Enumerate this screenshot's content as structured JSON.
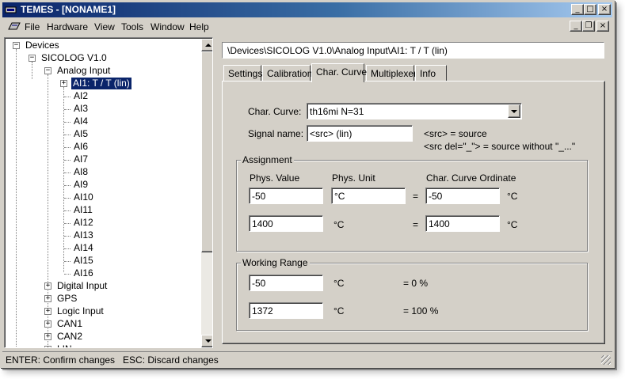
{
  "window": {
    "title": "TEMES - [NONAME1]"
  },
  "menu": {
    "items": [
      "File",
      "Hardware",
      "View",
      "Tools",
      "Window",
      "Help"
    ]
  },
  "caption_buttons": {
    "minimize": "_",
    "maximize": "□",
    "close": "×",
    "restore": "❐"
  },
  "tree": {
    "root": "Devices",
    "device": "SICOLOG V1.0",
    "analog_input": "Analog Input",
    "selected": "AI1: T / T (lin)",
    "analog_channels": [
      "AI2",
      "AI3",
      "AI4",
      "AI5",
      "AI6",
      "AI7",
      "AI8",
      "AI9",
      "AI10",
      "AI11",
      "AI12",
      "AI13",
      "AI14",
      "AI15",
      "AI16"
    ],
    "other_groups": [
      "Digital Input",
      "GPS",
      "Logic Input",
      "CAN1",
      "CAN2",
      "LIN"
    ],
    "expand_glyph": "+",
    "collapse_glyph": "−"
  },
  "path": "\\Devices\\SICOLOG V1.0\\Analog Input\\AI1: T / T (lin)",
  "tabs": [
    "Settings",
    "Calibration",
    "Char. Curve",
    "Multiplexer",
    "Info"
  ],
  "active_tab": "Char. Curve",
  "char_curve": {
    "label": "Char. Curve:",
    "value": "th16mi N=31",
    "signal_label": "Signal name:",
    "signal_value": "<src> (lin)",
    "hint_1": "<src> = source",
    "hint_2": "<src del=\"_\"> = source without \"_...\""
  },
  "assignment": {
    "caption": "Assignment",
    "col_phys_value": "Phys. Value",
    "col_phys_unit": "Phys. Unit",
    "col_ordinate": "Char. Curve Ordinate",
    "row1": {
      "phys_value": "-50",
      "unit": "°C",
      "eq": "=",
      "ordinate": "-50",
      "ordinate_unit": "°C"
    },
    "row2": {
      "phys_value": "1400",
      "unit": "°C",
      "eq": "=",
      "ordinate": "1400",
      "ordinate_unit": "°C"
    }
  },
  "working_range": {
    "caption": "Working Range",
    "row1": {
      "value": "-50",
      "unit": "°C",
      "pct": "= 0 %"
    },
    "row2": {
      "value": "1372",
      "unit": "°C",
      "pct": "= 100 %"
    }
  },
  "status": {
    "text": "ENTER: Confirm changes   ESC: Discard changes"
  },
  "colors": {
    "title_start": "#0a246a",
    "title_end": "#a6caf0",
    "face": "#d4d0c8",
    "selection": "#0a246a"
  }
}
